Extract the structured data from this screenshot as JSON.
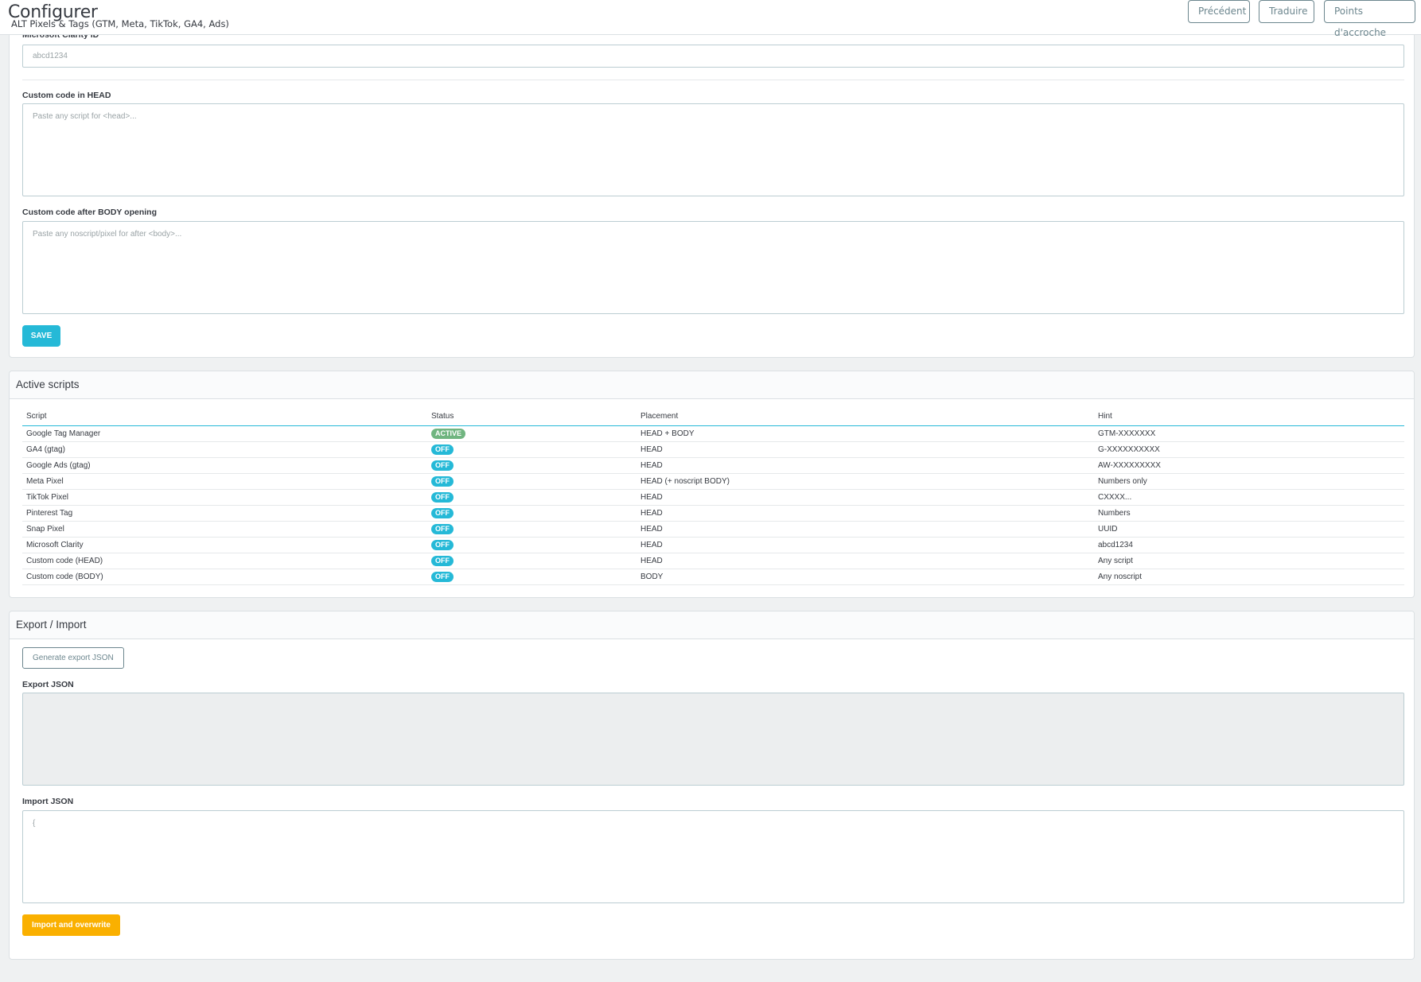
{
  "header": {
    "title": "Configurer",
    "subtitle": "ALT Pixels & Tags (GTM, Meta, TikTok, GA4, Ads)",
    "buttons": {
      "previous": "Précédent",
      "translate": "Traduire",
      "hooks": "Points d'accroche"
    }
  },
  "settings": {
    "clarity_label": "Microsoft Clarity ID",
    "clarity_placeholder": "abcd1234",
    "head_label": "Custom code in HEAD",
    "head_placeholder": "Paste any script for <head>...",
    "body_label": "Custom code after BODY opening",
    "body_placeholder": "Paste any noscript/pixel for after <body>...",
    "save_label": "SAVE"
  },
  "active_scripts": {
    "title": "Active scripts",
    "columns": [
      "Script",
      "Status",
      "Placement",
      "Hint"
    ],
    "rows": [
      {
        "script": "Google Tag Manager",
        "status": "ACTIVE",
        "placement": "HEAD + BODY",
        "hint": "GTM-XXXXXXX"
      },
      {
        "script": "GA4 (gtag)",
        "status": "OFF",
        "placement": "HEAD",
        "hint": "G-XXXXXXXXXX"
      },
      {
        "script": "Google Ads (gtag)",
        "status": "OFF",
        "placement": "HEAD",
        "hint": "AW-XXXXXXXXX"
      },
      {
        "script": "Meta Pixel",
        "status": "OFF",
        "placement": "HEAD (+ noscript BODY)",
        "hint": "Numbers only"
      },
      {
        "script": "TikTok Pixel",
        "status": "OFF",
        "placement": "HEAD",
        "hint": "CXXXX..."
      },
      {
        "script": "Pinterest Tag",
        "status": "OFF",
        "placement": "HEAD",
        "hint": "Numbers"
      },
      {
        "script": "Snap Pixel",
        "status": "OFF",
        "placement": "HEAD",
        "hint": "UUID"
      },
      {
        "script": "Microsoft Clarity",
        "status": "OFF",
        "placement": "HEAD",
        "hint": "abcd1234"
      },
      {
        "script": "Custom code (HEAD)",
        "status": "OFF",
        "placement": "HEAD",
        "hint": "Any script"
      },
      {
        "script": "Custom code (BODY)",
        "status": "OFF",
        "placement": "BODY",
        "hint": "Any noscript"
      }
    ]
  },
  "export_import": {
    "title": "Export / Import",
    "generate_label": "Generate export JSON",
    "export_label": "Export JSON",
    "import_label": "Import JSON",
    "import_placeholder": "{",
    "import_button": "Import and overwrite"
  },
  "colors": {
    "primary": "#25b9d7",
    "success": "#70b580",
    "warning": "#fab000"
  }
}
